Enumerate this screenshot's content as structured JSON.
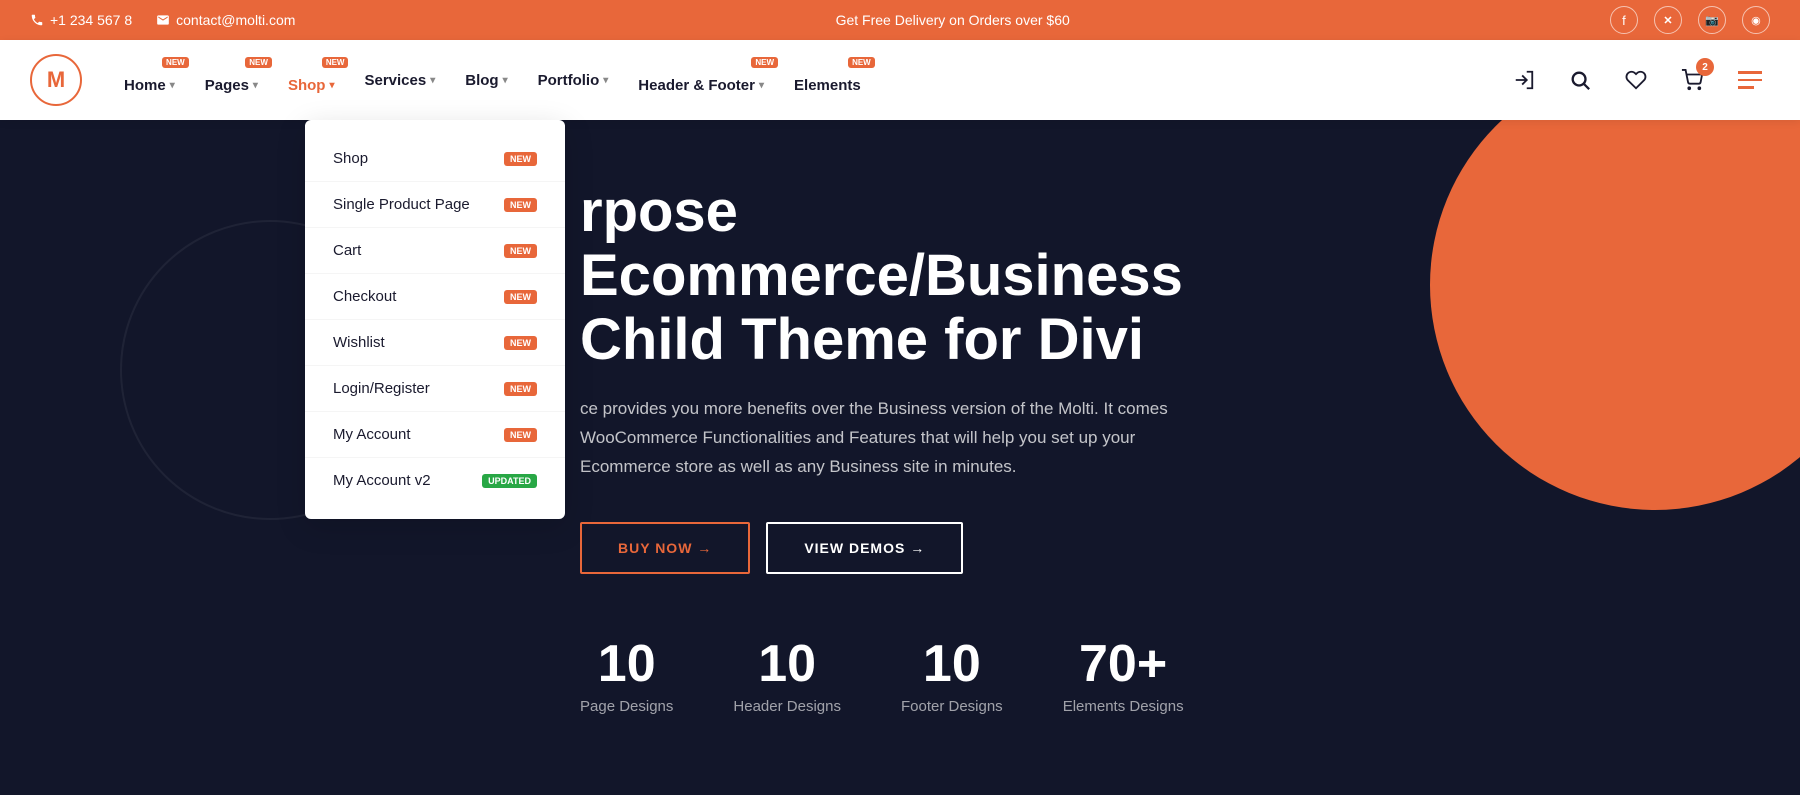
{
  "topbar": {
    "phone": "+1 234 567 8",
    "email": "contact@molti.com",
    "promo": "Get Free Delivery on Orders over $60",
    "socials": [
      "f",
      "𝕏",
      "📷",
      "◎"
    ]
  },
  "header": {
    "logo_letter": "M",
    "nav": [
      {
        "label": "Home",
        "badge": "NEW",
        "has_dropdown": true
      },
      {
        "label": "Pages",
        "badge": "NEW",
        "has_dropdown": true
      },
      {
        "label": "Shop",
        "badge": "NEW",
        "has_dropdown": true,
        "active": true
      },
      {
        "label": "Services",
        "badge": "",
        "has_dropdown": true
      },
      {
        "label": "Blog",
        "badge": "",
        "has_dropdown": true
      },
      {
        "label": "Portfolio",
        "badge": "",
        "has_dropdown": true
      },
      {
        "label": "Header & Footer",
        "badge": "NEW",
        "has_dropdown": true
      },
      {
        "label": "Elements",
        "badge": "NEW",
        "has_dropdown": false
      }
    ],
    "cart_count": "2"
  },
  "shop_dropdown": {
    "items": [
      {
        "label": "Shop",
        "badge": "NEW",
        "badge_type": "orange"
      },
      {
        "label": "Single Product Page",
        "badge": "NEW",
        "badge_type": "orange"
      },
      {
        "label": "Cart",
        "badge": "NEW",
        "badge_type": "orange"
      },
      {
        "label": "Checkout",
        "badge": "NEW",
        "badge_type": "orange"
      },
      {
        "label": "Wishlist",
        "badge": "NEW",
        "badge_type": "orange"
      },
      {
        "label": "Login/Register",
        "badge": "NEW",
        "badge_type": "orange"
      },
      {
        "label": "My Account",
        "badge": "NEW",
        "badge_type": "orange"
      },
      {
        "label": "My Account v2",
        "badge": "UPDATED",
        "badge_type": "green"
      }
    ]
  },
  "hero": {
    "title_line1": "rpose Ecommerce/Business",
    "title_line2": "Child Theme for Divi",
    "description": "ce provides you more benefits over the Business version of the Molti. It comes\nWooCommerce Functionalities and Features that will help you set up your\nEcommerce store as well as any Business site in minutes.",
    "btn_buy": "BUY NOW →",
    "btn_demos": "VIEW DEMOS →",
    "stats": [
      {
        "number": "10",
        "label": "Page Designs"
      },
      {
        "number": "10",
        "label": "Header Designs"
      },
      {
        "number": "10",
        "label": "Footer Designs"
      },
      {
        "number": "70+",
        "label": "Elements Designs"
      }
    ]
  }
}
